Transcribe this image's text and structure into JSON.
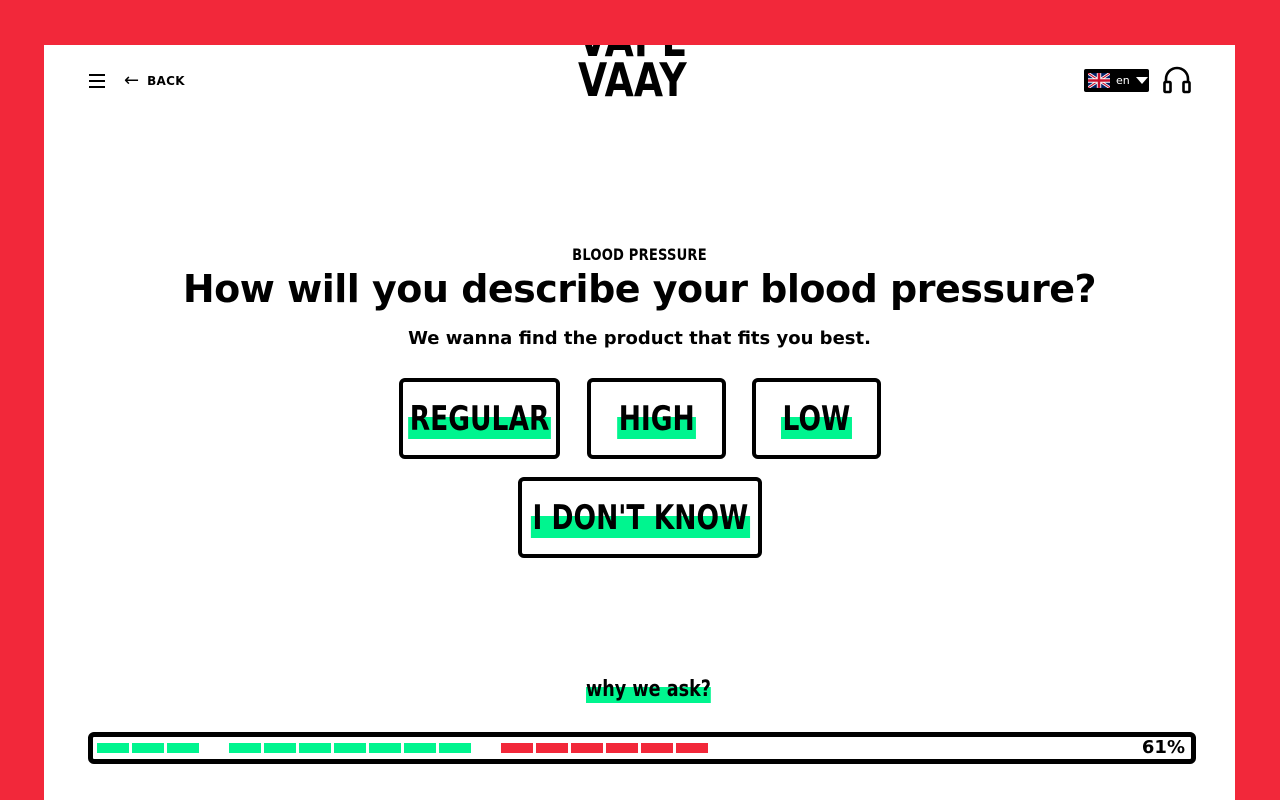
{
  "header": {
    "back_label": "BACK",
    "logo_line1": "VAPE",
    "logo_line2": "VAAY",
    "language_code": "en"
  },
  "question": {
    "category": "BLOOD PRESSURE",
    "title": "How will you describe your blood pressure?",
    "subtitle": "We wanna find the product that fits you best."
  },
  "options": [
    "REGULAR",
    "HIGH",
    "LOW",
    "I DON'T KNOW"
  ],
  "why_link": "why we ask?",
  "progress": {
    "percent_label": "61%",
    "value": 0.61,
    "groups": [
      {
        "color": "#00f58f",
        "count": 3
      },
      {
        "color": "#00f58f",
        "count": 7
      },
      {
        "color": "#f2283a",
        "count": 6
      }
    ]
  },
  "colors": {
    "frame": "#f2283a",
    "accent": "#00f58f",
    "text": "#000000"
  }
}
